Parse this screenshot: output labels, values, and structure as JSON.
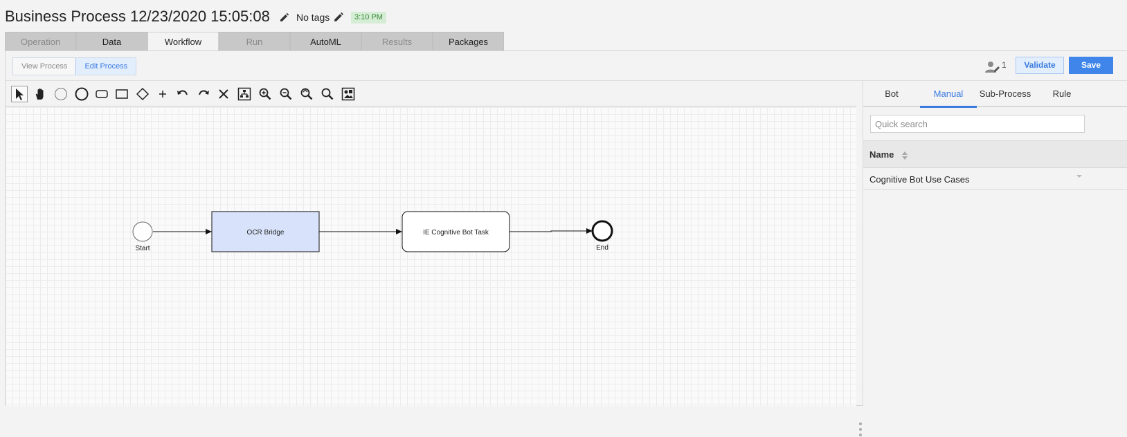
{
  "header": {
    "title": "Business Process 12/23/2020 15:05:08",
    "tags_label": "No tags",
    "time_badge": "3:10 PM"
  },
  "tabs": [
    {
      "label": "Operation",
      "state": "disabled"
    },
    {
      "label": "Data",
      "state": "normal"
    },
    {
      "label": "Workflow",
      "state": "active"
    },
    {
      "label": "Run",
      "state": "disabled"
    },
    {
      "label": "AutoML",
      "state": "normal"
    },
    {
      "label": "Results",
      "state": "disabled"
    },
    {
      "label": "Packages",
      "state": "normal"
    }
  ],
  "mode": {
    "view_label": "View Process",
    "edit_label": "Edit Process",
    "active": "Edit Process"
  },
  "actions": {
    "collaborators_count": "1",
    "validate_label": "Validate",
    "save_label": "Save"
  },
  "toolbar": {
    "tools": [
      "select-pointer-icon",
      "pan-hand-icon",
      "start-event-icon",
      "end-event-icon",
      "task-icon",
      "subprocess-icon",
      "gateway-icon",
      "add-icon",
      "undo-icon",
      "redo-icon",
      "delete-icon",
      "auto-layout-icon",
      "zoom-in-icon",
      "zoom-out-icon",
      "zoom-reset-icon",
      "zoom-fit-icon",
      "export-image-icon"
    ],
    "selected": "select-pointer-icon"
  },
  "diagram": {
    "start_label": "Start",
    "end_label": "End",
    "task1_label": "OCR Bridge",
    "task2_label": "IE Cognitive Bot Task",
    "task1_fill": "#d8e3fb"
  },
  "panel": {
    "tabs": [
      "Bot",
      "Manual",
      "Sub-Process",
      "Rule"
    ],
    "active_tab": "Manual",
    "search_placeholder": "Quick search",
    "column_name": "Name",
    "rows": [
      "Cognitive Bot Use Cases"
    ]
  },
  "colors": {
    "accent": "#3f85ea",
    "badge_bg": "#d4edd4",
    "badge_text": "#3c8a3c"
  }
}
